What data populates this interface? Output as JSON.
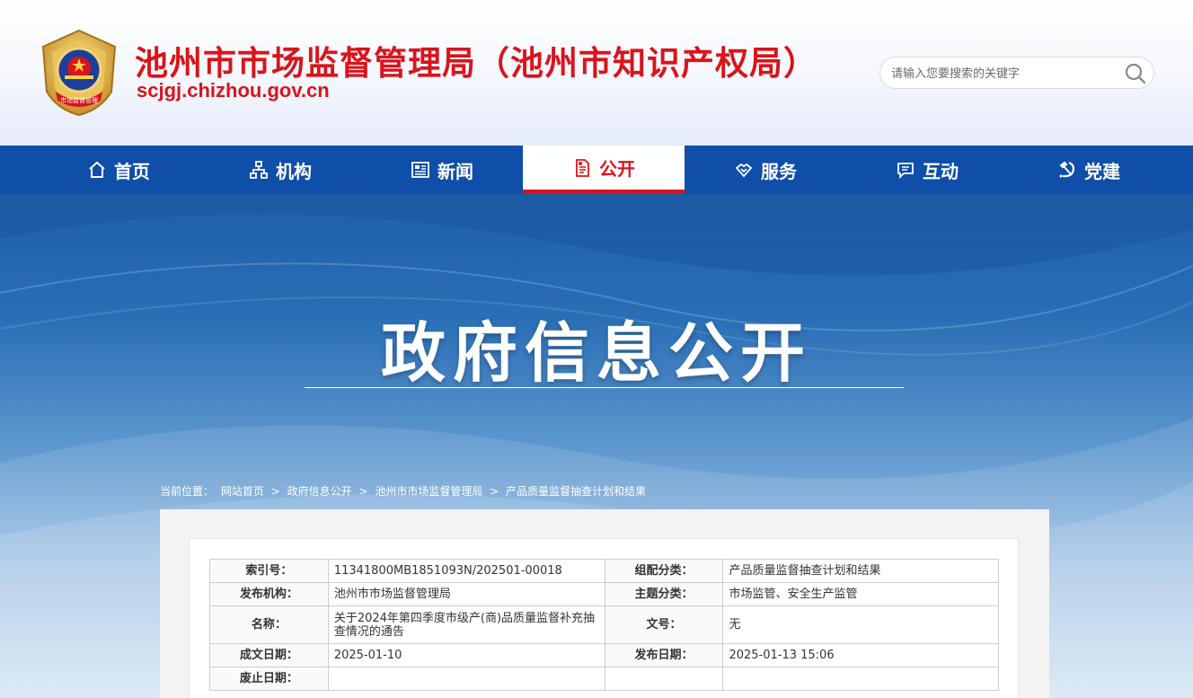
{
  "header": {
    "title": "池州市市场监督管理局（池州市知识产权局）",
    "domain": "scjgj.chizhou.gov.cn",
    "emblem_text": "市场监督管理",
    "search": {
      "placeholder": "请输入您要搜索的关键字"
    }
  },
  "nav": {
    "items": [
      {
        "label": "首页",
        "icon": "home-icon"
      },
      {
        "label": "机构",
        "icon": "org-chart-icon"
      },
      {
        "label": "新闻",
        "icon": "newspaper-icon"
      },
      {
        "label": "公开",
        "icon": "document-icon",
        "active": true
      },
      {
        "label": "服务",
        "icon": "handshake-icon"
      },
      {
        "label": "互动",
        "icon": "chat-icon"
      },
      {
        "label": "党建",
        "icon": "hammer-sickle-icon"
      }
    ]
  },
  "banner": {
    "title": "政府信息公开"
  },
  "breadcrumb": {
    "prefix": "当前位置：",
    "items": [
      "网站首页",
      "政府信息公开",
      "池州市市场监督管理局",
      "产品质量监督抽查计划和结果"
    ],
    "separator": ">"
  },
  "meta": {
    "rows": [
      {
        "k1": "索引号：",
        "v1": "11341800MB1851093N/202501-00018",
        "k2": "组配分类：",
        "v2": "产品质量监督抽查计划和结果"
      },
      {
        "k1": "发布机构：",
        "v1": "池州市市场监督管理局",
        "k2": "主题分类：",
        "v2": "市场监管、安全生产监管"
      },
      {
        "k1": "名称：",
        "v1": "关于2024年第四季度市级产(商)品质量监督补充抽查情况的通告",
        "k2": "文号：",
        "v2": "无"
      },
      {
        "k1": "成文日期：",
        "v1": "2025-01-10",
        "k2": "发布日期：",
        "v2": "2025-01-13 15:06"
      },
      {
        "k1": "废止日期：",
        "v1": "",
        "k2": "",
        "v2": ""
      }
    ]
  },
  "colors": {
    "brand_red": "#d9141b",
    "nav_blue": "#0f4ea9"
  }
}
